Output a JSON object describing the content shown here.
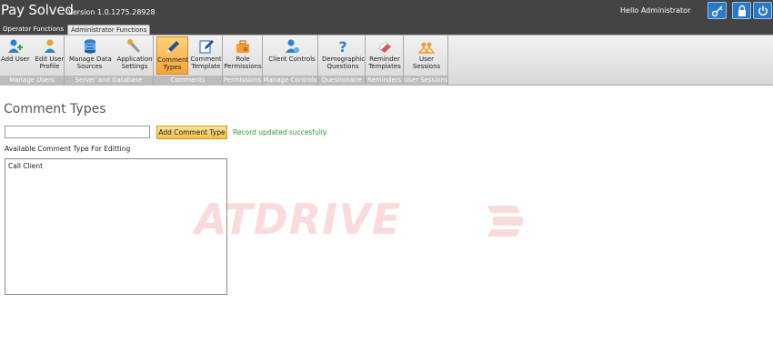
{
  "app": {
    "name": "Pay Solved",
    "version": "Version 1.0.1275.28928",
    "greeting": "Hello Administrator"
  },
  "top_buttons": [
    {
      "name": "key-icon"
    },
    {
      "name": "lock-icon"
    },
    {
      "name": "power-icon"
    }
  ],
  "tabs": [
    {
      "label": "Operator Functions",
      "active": false
    },
    {
      "label": "Administrator Functions",
      "active": true
    }
  ],
  "ribbon": {
    "groups": [
      {
        "label": "Manage Users"
      },
      {
        "label": "Server and Database"
      },
      {
        "label": "Comments"
      },
      {
        "label": "Permissions"
      },
      {
        "label": "Manage Controls"
      },
      {
        "label": "Questionaire"
      },
      {
        "label": "Reminders"
      },
      {
        "label": "User Sessions"
      }
    ],
    "buttons": [
      {
        "line1": "Add User",
        "line2": "",
        "icon": "add-user-icon"
      },
      {
        "line1": "Edit User",
        "line2": "Profile",
        "icon": "edit-user-icon"
      },
      {
        "line1": "Manage Data",
        "line2": "Sources",
        "icon": "database-icon"
      },
      {
        "line1": "Application",
        "line2": "Settings",
        "icon": "wrench-icon"
      },
      {
        "line1": "Comment",
        "line2": "Types",
        "icon": "pen-icon",
        "selected": true
      },
      {
        "line1": "Comment",
        "line2": "Template",
        "icon": "edit-template-icon"
      },
      {
        "line1": "Role",
        "line2": "Permissions",
        "icon": "briefcase-icon"
      },
      {
        "line1": "Client Controls",
        "line2": "",
        "icon": "client-controls-icon"
      },
      {
        "line1": "Demographic",
        "line2": "Questions",
        "icon": "question-icon"
      },
      {
        "line1": "Reminder",
        "line2": "Templates",
        "icon": "eraser-icon"
      },
      {
        "line1": "User",
        "line2": "Sessions",
        "icon": "users-icon"
      }
    ]
  },
  "page": {
    "title": "Comment Types",
    "input_value": "",
    "add_button_label": "Add Comment Type",
    "status_message": "Record updated succesfully.",
    "available_label": "Available Comment Type For Editting",
    "list_items": [
      "Call Client"
    ]
  },
  "watermark": {
    "text": "ATDRIVE"
  },
  "colors": {
    "titlebar": "#444444",
    "accent_blue": "#2a78c8",
    "selected_orange": "#f4a43a",
    "success_green": "#2e9b2e"
  }
}
